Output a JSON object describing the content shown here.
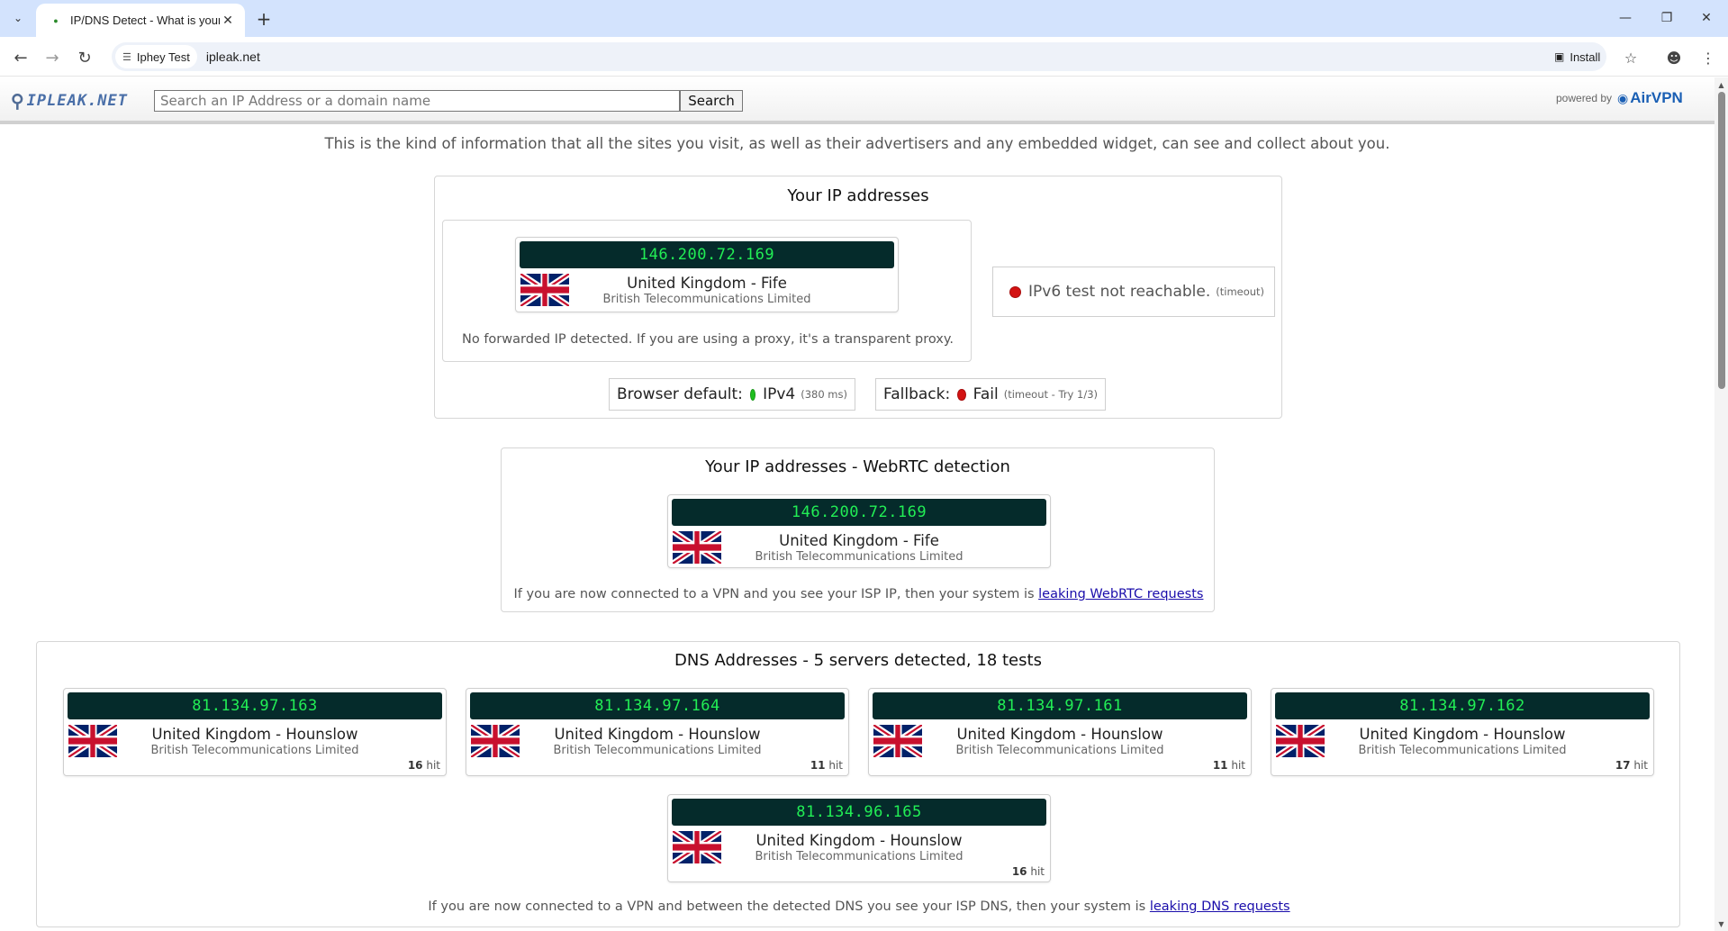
{
  "browser": {
    "tab_title": "IP/DNS Detect - What is your IP",
    "site_chip": "Iphey Test",
    "url": "ipleak.net",
    "install_label": "Install"
  },
  "header": {
    "logo_text": "IPLEAK.NET",
    "search_placeholder": "Search an IP Address or a domain name",
    "search_button": "Search",
    "powered_by": "powered by",
    "powered_name": "AirVPN"
  },
  "intro": "This is the kind of information that all the sites you visit, as well as their advertisers and any embedded widget, can see and collect about you.",
  "ip_section": {
    "title": "Your IP addresses",
    "ip": "146.200.72.169",
    "location": "United Kingdom - Fife",
    "isp": "British Telecommunications Limited",
    "forwarded_note": "No forwarded IP detected. If you are using a proxy, it's a transparent proxy.",
    "ipv6_text": "IPv6 test not reachable.",
    "ipv6_detail": "(timeout)",
    "browser_default_label": "Browser default:",
    "browser_default_value": "IPv4",
    "browser_default_detail": "(380 ms)",
    "fallback_label": "Fallback:",
    "fallback_value": "Fail",
    "fallback_detail": "(timeout - Try 1/3)"
  },
  "webrtc_section": {
    "title": "Your IP addresses - WebRTC detection",
    "ip": "146.200.72.169",
    "location": "United Kingdom - Fife",
    "isp": "British Telecommunications Limited",
    "note_text": "If you are now connected to a VPN and you see your ISP IP, then your system is",
    "note_link": "leaking WebRTC requests"
  },
  "dns_section": {
    "title": "DNS Addresses - 5 servers detected, 18 tests",
    "hit_label": "hit",
    "servers": [
      {
        "ip": "81.134.97.163",
        "location": "United Kingdom - Hounslow",
        "isp": "British Telecommunications Limited",
        "hits": "16"
      },
      {
        "ip": "81.134.97.164",
        "location": "United Kingdom - Hounslow",
        "isp": "British Telecommunications Limited",
        "hits": "11"
      },
      {
        "ip": "81.134.97.161",
        "location": "United Kingdom - Hounslow",
        "isp": "British Telecommunications Limited",
        "hits": "11"
      },
      {
        "ip": "81.134.97.162",
        "location": "United Kingdom - Hounslow",
        "isp": "British Telecommunications Limited",
        "hits": "17"
      },
      {
        "ip": "81.134.96.165",
        "location": "United Kingdom - Hounslow",
        "isp": "British Telecommunications Limited",
        "hits": "16"
      }
    ],
    "note_text": "If you are now connected to a VPN and between the detected DNS you see your ISP DNS, then your system is",
    "note_link": "leaking DNS requests"
  },
  "colors": {
    "ip_bar_bg": "#052b2b",
    "ip_text": "#22ee55",
    "status_ok": "#1fbf1f",
    "status_fail": "#d31212",
    "link": "#1a0dab"
  }
}
